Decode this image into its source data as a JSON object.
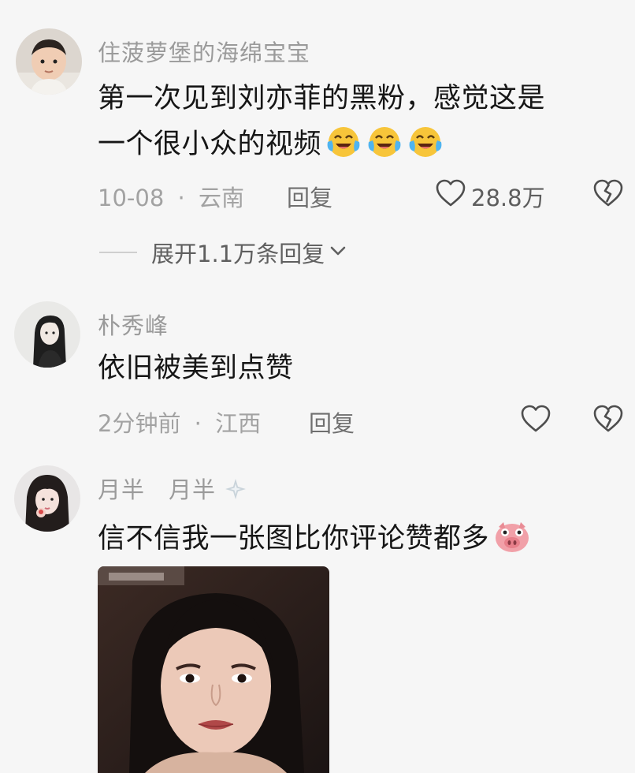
{
  "comments": [
    {
      "username": "住菠萝堡的海绵宝宝",
      "line1": "第一次见到刘亦菲的黑粉，感觉这是",
      "line2": "一个很小众的视频",
      "emojis": [
        "crying-laughing-emoji",
        "crying-laughing-emoji",
        "crying-laughing-emoji"
      ],
      "time": "10-08",
      "location": "云南",
      "reply_label": "回复",
      "like_count": "28.8万",
      "expand_label": "展开1.1万条回复"
    },
    {
      "username": "朴秀峰",
      "line1": "依旧被美到点赞",
      "time": "2分钟前",
      "location": "江西",
      "reply_label": "回复"
    },
    {
      "username": "月半　月半",
      "line1": "信不信我一张图比你评论赞都多",
      "emojis": [
        "pig-emoji"
      ]
    }
  ],
  "separator": "·",
  "icons": {
    "like": "heart-outline-icon",
    "dislike": "broken-heart-icon",
    "expand": "chevron-down-icon",
    "name_badge": "sparkle-icon"
  },
  "colors": {
    "background": "#f6f6f6",
    "text": "#161616",
    "muted": "#9a9a9a",
    "emoji_yellow": "#f7c53a",
    "pig_pink": "#f1a0a8"
  }
}
